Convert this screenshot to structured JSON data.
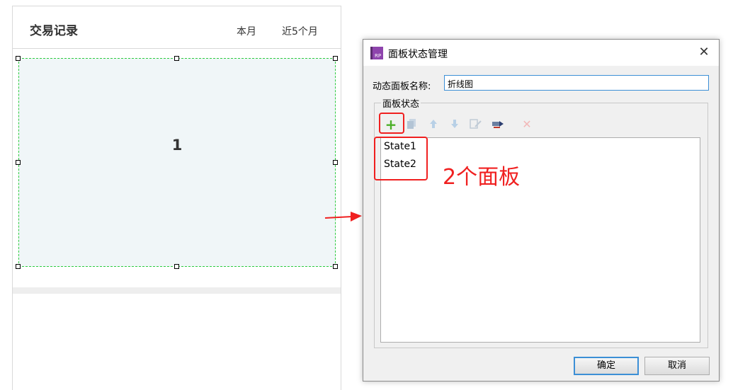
{
  "page": {
    "title": "交易记录",
    "tabs": [
      "本月",
      "近5个月"
    ],
    "panel_label": "1"
  },
  "dialog": {
    "icon_text": "RP",
    "title": "面板状态管理",
    "name_label": "动态面板名称:",
    "name_value": "折线图",
    "group_label": "面板状态",
    "toolbar_icons": [
      "add-icon",
      "copy-icon",
      "move-up-icon",
      "move-down-icon",
      "edit-icon",
      "edit-all-icon",
      "delete-icon"
    ],
    "states": [
      "State1",
      "State2"
    ],
    "ok_label": "确定",
    "cancel_label": "取消",
    "close_glyph": "✕"
  },
  "annotation": {
    "text": "2个面板",
    "color": "#f02020"
  },
  "colors": {
    "panel_border": "#2ecc40",
    "panel_fill": "#f0f6f8",
    "add_icon": "#4caf28"
  }
}
